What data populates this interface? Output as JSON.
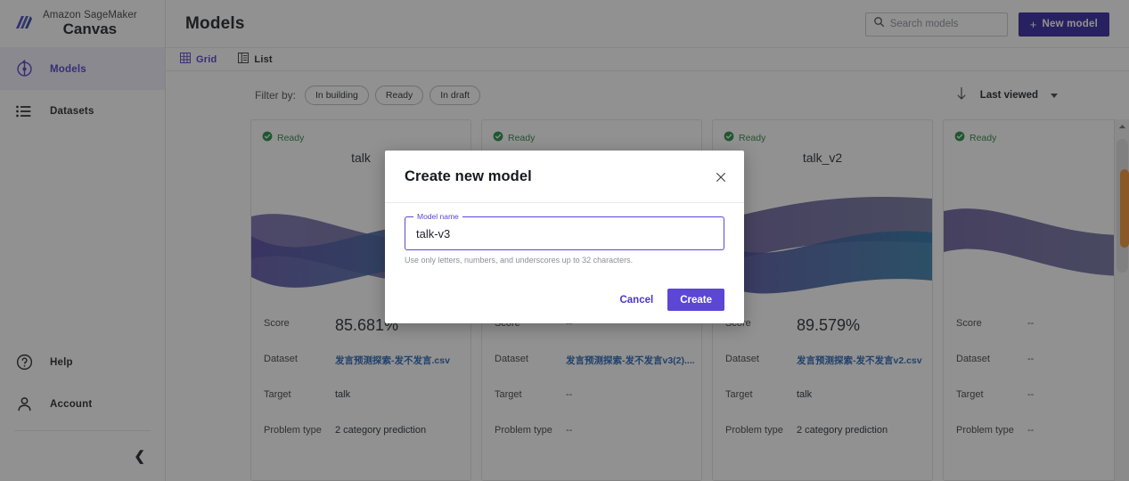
{
  "sidebar": {
    "brand": {
      "line1": "Amazon SageMaker",
      "line2": "Canvas",
      "logo_icon": "sagemaker-logo-icon"
    },
    "items": [
      {
        "label": "Models",
        "icon": "models-icon",
        "active": true
      },
      {
        "label": "Datasets",
        "icon": "datasets-list-icon",
        "active": false
      }
    ],
    "bottom_items": [
      {
        "label": "Help",
        "icon": "help-circle-icon"
      },
      {
        "label": "Account",
        "icon": "user-account-icon"
      }
    ],
    "collapse_icon": "chevron-left-icon"
  },
  "topbar": {
    "title": "Models",
    "search": {
      "placeholder": "Search models",
      "value": "",
      "icon": "search-icon"
    },
    "new_model_button": {
      "label": "New model",
      "icon": "plus-icon"
    }
  },
  "viewbar": {
    "tabs": [
      {
        "label": "Grid",
        "icon": "grid-view-icon",
        "active": true
      },
      {
        "label": "List",
        "icon": "list-view-icon",
        "active": false
      }
    ]
  },
  "filterbar": {
    "label": "Filter by:",
    "chips": [
      "In building",
      "Ready",
      "In draft"
    ],
    "sort": {
      "icon": "arrow-down-icon",
      "label": "Last viewed",
      "caret_icon": "caret-down-icon"
    }
  },
  "cards": [
    {
      "status": "Ready",
      "status_icon": "check-circle-icon",
      "title": "talk",
      "rows": [
        {
          "key": "Score",
          "value": "85.681%",
          "style": "score"
        },
        {
          "key": "Dataset",
          "value": "发言预测探索-发不发言.csv",
          "style": "link"
        },
        {
          "key": "Target",
          "value": "talk",
          "style": "plain"
        },
        {
          "key": "Problem type",
          "value": "2 category prediction",
          "style": "plain"
        }
      ]
    },
    {
      "status": "Ready",
      "status_icon": "check-circle-icon",
      "title": "",
      "rows": [
        {
          "key": "Score",
          "value": "--",
          "style": "plain"
        },
        {
          "key": "Dataset",
          "value": "发言预测探索-发不发言v3(2)....",
          "style": "link"
        },
        {
          "key": "Target",
          "value": "--",
          "style": "plain"
        },
        {
          "key": "Problem type",
          "value": "--",
          "style": "plain"
        }
      ]
    },
    {
      "status": "Ready",
      "status_icon": "check-circle-icon",
      "title": "talk_v2",
      "rows": [
        {
          "key": "Score",
          "value": "89.579%",
          "style": "score"
        },
        {
          "key": "Dataset",
          "value": "发言预测探索-发不发言v2.csv",
          "style": "link"
        },
        {
          "key": "Target",
          "value": "talk",
          "style": "plain"
        },
        {
          "key": "Problem type",
          "value": "2 category prediction",
          "style": "plain"
        }
      ]
    },
    {
      "status": "Ready",
      "status_icon": "check-circle-icon",
      "title": "",
      "rows": [
        {
          "key": "Score",
          "value": "--",
          "style": "plain"
        },
        {
          "key": "Dataset",
          "value": "--",
          "style": "plain"
        },
        {
          "key": "Target",
          "value": "--",
          "style": "plain"
        },
        {
          "key": "Problem type",
          "value": "--",
          "style": "plain"
        }
      ]
    }
  ],
  "modal": {
    "title": "Create new model",
    "close_icon": "close-icon",
    "field": {
      "legend": "Model name",
      "value": "talk-v3",
      "placeholder": "",
      "help": "Use only letters, numbers, and underscores up to 32 characters."
    },
    "cancel_label": "Cancel",
    "create_label": "Create"
  },
  "scrollbar": {
    "up_arrow_icon": "caret-up-icon"
  },
  "colors": {
    "accent": "#4b36c9",
    "primary_button": "#2d1f9e",
    "create_button": "#5b46d6",
    "status_green": "#2a7d3f",
    "link_blue": "#1f5fb3",
    "scroll_thumb": "#ef8b2c",
    "wave_purple": "#5b4ba8",
    "wave_teal": "#1d6ea0"
  }
}
